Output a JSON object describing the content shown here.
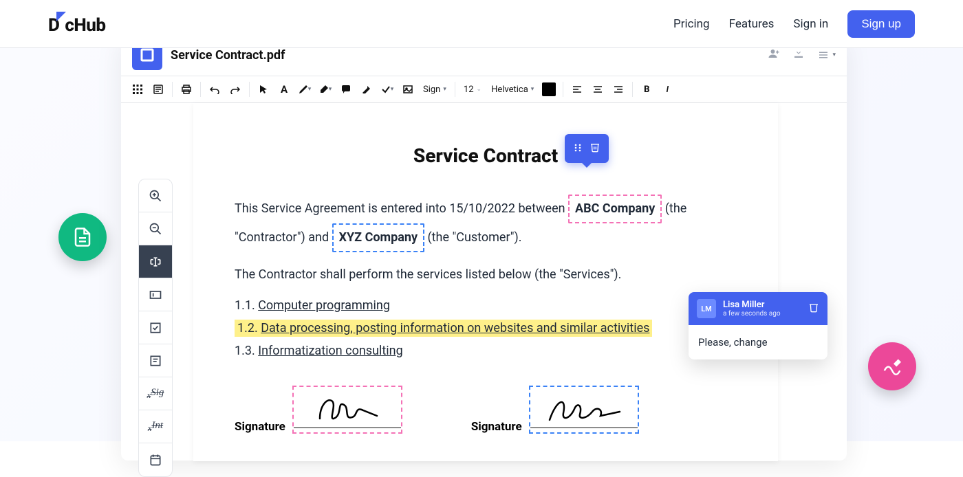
{
  "nav": {
    "logo": "DocHub",
    "pricing": "Pricing",
    "features": "Features",
    "signin": "Sign in",
    "signup": "Sign up"
  },
  "editor": {
    "doc_title": "Service Contract.pdf",
    "toolbar": {
      "sign": "Sign",
      "fontsize": "12",
      "font": "Helvetica"
    }
  },
  "siderail": {
    "sig_label": "Sig",
    "int_label": "Int"
  },
  "document": {
    "title": "Service Contract",
    "p1_a": "This Service Agreement is entered into 15/10/2022 between ",
    "field1": "ABC Company",
    "p1_b": " (the \"Contractor\") and ",
    "field2": "XYZ Company",
    "p1_c": " (the \"Customer\").",
    "p2": "The Contractor shall perform the services listed below (the \"Services\").",
    "s1_num": "1.1. ",
    "s1": "Computer programming",
    "s2_num": "1.2. ",
    "s2": "Data processing, posting information on websites and similar activities",
    "s3_num": "1.3. ",
    "s3": "Informatization consulting",
    "sig_label": "Signature"
  },
  "comment": {
    "initials": "LM",
    "name": "Lisa Miller",
    "time": "a few seconds ago",
    "body": "Please, change"
  }
}
